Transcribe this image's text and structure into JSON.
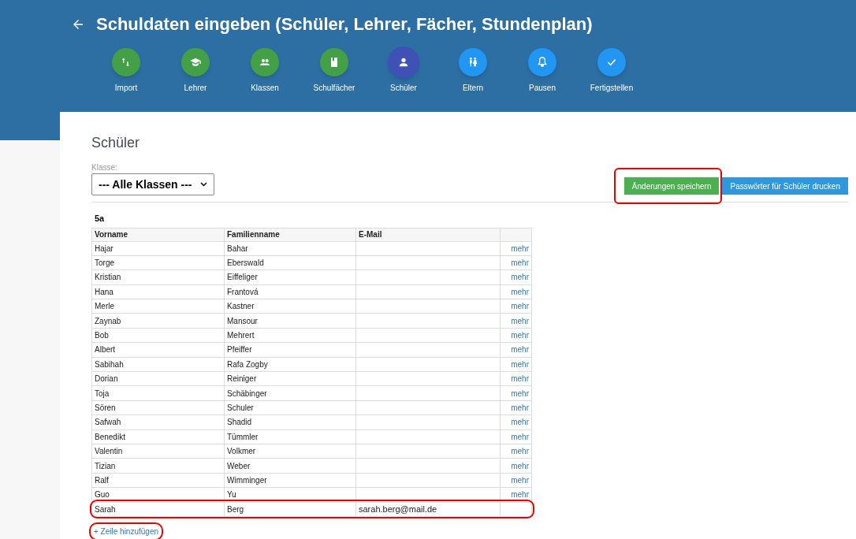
{
  "header": {
    "title": "Schuldaten eingeben (Schüler, Lehrer, Fächer, Stundenplan)"
  },
  "steps": [
    {
      "label": "Import",
      "kind": "import",
      "done": true,
      "selected": false
    },
    {
      "label": "Lehrer",
      "kind": "teacher",
      "done": true,
      "selected": false
    },
    {
      "label": "Klassen",
      "kind": "group",
      "done": true,
      "selected": false
    },
    {
      "label": "Schulfächer",
      "kind": "book",
      "done": true,
      "selected": false
    },
    {
      "label": "Schüler",
      "kind": "person",
      "done": false,
      "selected": true
    },
    {
      "label": "Eltern",
      "kind": "parents",
      "done": false,
      "selected": false
    },
    {
      "label": "Pausen",
      "kind": "bell",
      "done": false,
      "selected": false
    },
    {
      "label": "Fertigstellen",
      "kind": "check",
      "done": false,
      "selected": false
    }
  ],
  "page": {
    "heading": "Schüler",
    "class_select": {
      "label": "Klasse:",
      "value": "--- Alle Klassen ---"
    },
    "buttons": [
      {
        "label": "Änderungen speichern",
        "kind": "save",
        "highlighted": true
      },
      {
        "label": "Passwörter für Schüler drucken",
        "kind": "print",
        "highlighted": false
      }
    ]
  },
  "table": {
    "group": "5a",
    "columns": [
      "Vorname",
      "Familienname",
      "E-Mail"
    ],
    "rows": [
      {
        "first": "Hajar",
        "last": "Bahar",
        "email": "",
        "link": "mehr",
        "highlighted": false
      },
      {
        "first": "Torge",
        "last": "Eberswald",
        "email": "",
        "link": "mehr",
        "highlighted": false
      },
      {
        "first": "Kristian",
        "last": "Eiffeliger",
        "email": "",
        "link": "mehr",
        "highlighted": false
      },
      {
        "first": "Hana",
        "last": "Frantová",
        "email": "",
        "link": "mehr",
        "highlighted": false
      },
      {
        "first": "Merle",
        "last": "Kastner",
        "email": "",
        "link": "mehr",
        "highlighted": false
      },
      {
        "first": "Zaynab",
        "last": "Mansour",
        "email": "",
        "link": "mehr",
        "highlighted": false
      },
      {
        "first": "Bob",
        "last": "Mehrert",
        "email": "",
        "link": "mehr",
        "highlighted": false
      },
      {
        "first": "Albert",
        "last": "Pfeiffer",
        "email": "",
        "link": "mehr",
        "highlighted": false
      },
      {
        "first": "Sabihah",
        "last": "Rafa Zogby",
        "email": "",
        "link": "mehr",
        "highlighted": false
      },
      {
        "first": "Dorian",
        "last": "Reiniger",
        "email": "",
        "link": "mehr",
        "highlighted": false
      },
      {
        "first": "Toja",
        "last": "Schäbinger",
        "email": "",
        "link": "mehr",
        "highlighted": false
      },
      {
        "first": "Sören",
        "last": "Schuler",
        "email": "",
        "link": "mehr",
        "highlighted": false
      },
      {
        "first": "Safwah",
        "last": "Shadid",
        "email": "",
        "link": "mehr",
        "highlighted": false
      },
      {
        "first": "Benedikt",
        "last": "Tümmler",
        "email": "",
        "link": "mehr",
        "highlighted": false
      },
      {
        "first": "Valentin",
        "last": "Volkmer",
        "email": "",
        "link": "mehr",
        "highlighted": false
      },
      {
        "first": "Tizian",
        "last": "Weber",
        "email": "",
        "link": "mehr",
        "highlighted": false
      },
      {
        "first": "Ralf",
        "last": "Wimminger",
        "email": "",
        "link": "mehr",
        "highlighted": false
      },
      {
        "first": "Guo",
        "last": "Yu",
        "email": "",
        "link": "mehr",
        "highlighted": false
      },
      {
        "first": "Sarah",
        "last": "Berg",
        "email": "sarah.berg@mail.de",
        "link": "",
        "highlighted": true
      }
    ],
    "add_row": {
      "label": "+ Zeile hinzufügen",
      "highlighted": true
    }
  }
}
